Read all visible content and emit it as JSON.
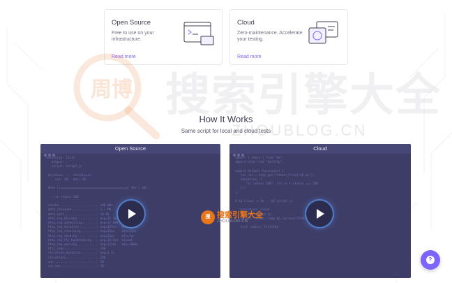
{
  "cards": [
    {
      "title": "Open Source",
      "desc": "Free to use on your infrastructure.",
      "link": "Read more"
    },
    {
      "title": "Cloud",
      "desc": "Zero-maintenance. Accelerate your testing.",
      "link": "Read more"
    }
  ],
  "section": {
    "title": "How It Works",
    "subtitle": "Same script for local and cloud tests"
  },
  "panels": [
    {
      "label": "Open Source"
    },
    {
      "label": "Cloud"
    }
  ],
  "watermark": {
    "text": "搜索引擎大全",
    "sub": "ZHOUBLOG.CN",
    "emblem": "周博"
  },
  "logo2": {
    "emblem": "搜",
    "text": "搜索引擎大全",
    "sub": "ZHOUBLOG.CN"
  },
  "colors": {
    "accent": "#7d64ff",
    "panel_bg": "#3d3d68",
    "panel_bar": "#474775"
  },
  "icons": {
    "play": "play-icon",
    "help": "help-icon"
  }
}
